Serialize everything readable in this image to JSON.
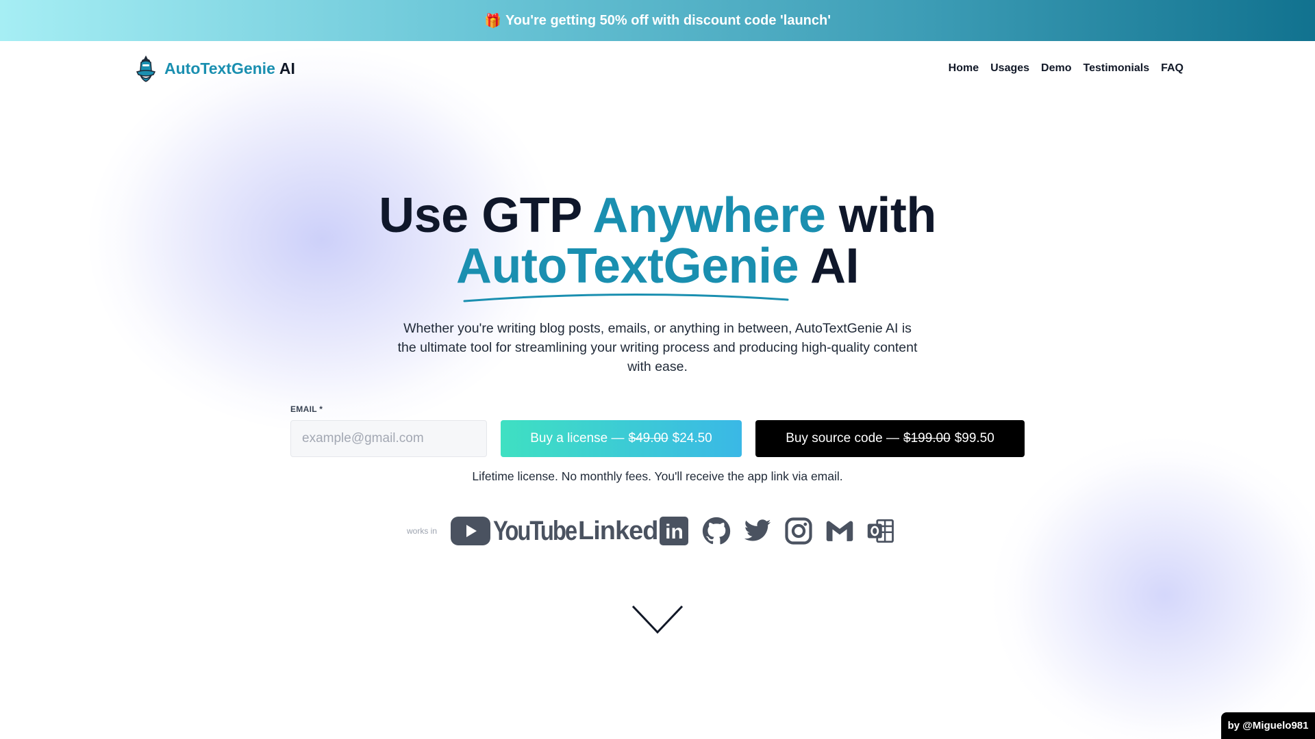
{
  "promo": {
    "gift_icon": "gift-icon",
    "text": "You're getting 50% off with discount code 'launch'"
  },
  "header": {
    "logo_icon": "genie-lamp-icon",
    "brand_name": "AutoTextGenie",
    "brand_suffix": "AI",
    "nav": [
      {
        "label": "Home"
      },
      {
        "label": "Usages"
      },
      {
        "label": "Demo"
      },
      {
        "label": "Testimonials"
      },
      {
        "label": "FAQ"
      }
    ]
  },
  "hero": {
    "title_part1": "Use GTP ",
    "title_highlight1": "Anywhere",
    "title_part2": " with",
    "title_highlight2": "AutoTextGenie",
    "title_part3": " AI",
    "subtitle": "Whether you're writing blog posts, emails, or anything in between, AutoTextGenie AI is the ultimate tool for streamlining your writing process and producing high-quality content with ease."
  },
  "form": {
    "email_label": "EMAIL *",
    "email_placeholder": "example@gmail.com",
    "email_value": "",
    "license_button": {
      "label": "Buy a license —",
      "old_price": "$49.00",
      "new_price": "$24.50"
    },
    "source_button": {
      "label": "Buy source code —",
      "old_price": "$199.00",
      "new_price": "$99.50"
    },
    "note": "Lifetime license. No monthly fees. You'll receive the app link via email."
  },
  "works_in": {
    "label": "works in",
    "youtube_text": "YouTube",
    "linkedin_text": "Linked",
    "linkedin_box": "in",
    "icons": [
      "youtube-icon",
      "linkedin-icon",
      "github-icon",
      "twitter-icon",
      "instagram-icon",
      "gmail-icon",
      "outlook-icon"
    ]
  },
  "scroll_icon": "chevron-down-icon",
  "credit": "by @Miguelo981",
  "colors": {
    "brand": "#1a8fb0",
    "dark_text": "#0f172a",
    "logo_gray": "#4a5260",
    "license_gradient_start": "#3fe0c2",
    "license_gradient_end": "#3ab8e6",
    "banner_start": "#a6eef4",
    "banner_end": "#11728f"
  }
}
